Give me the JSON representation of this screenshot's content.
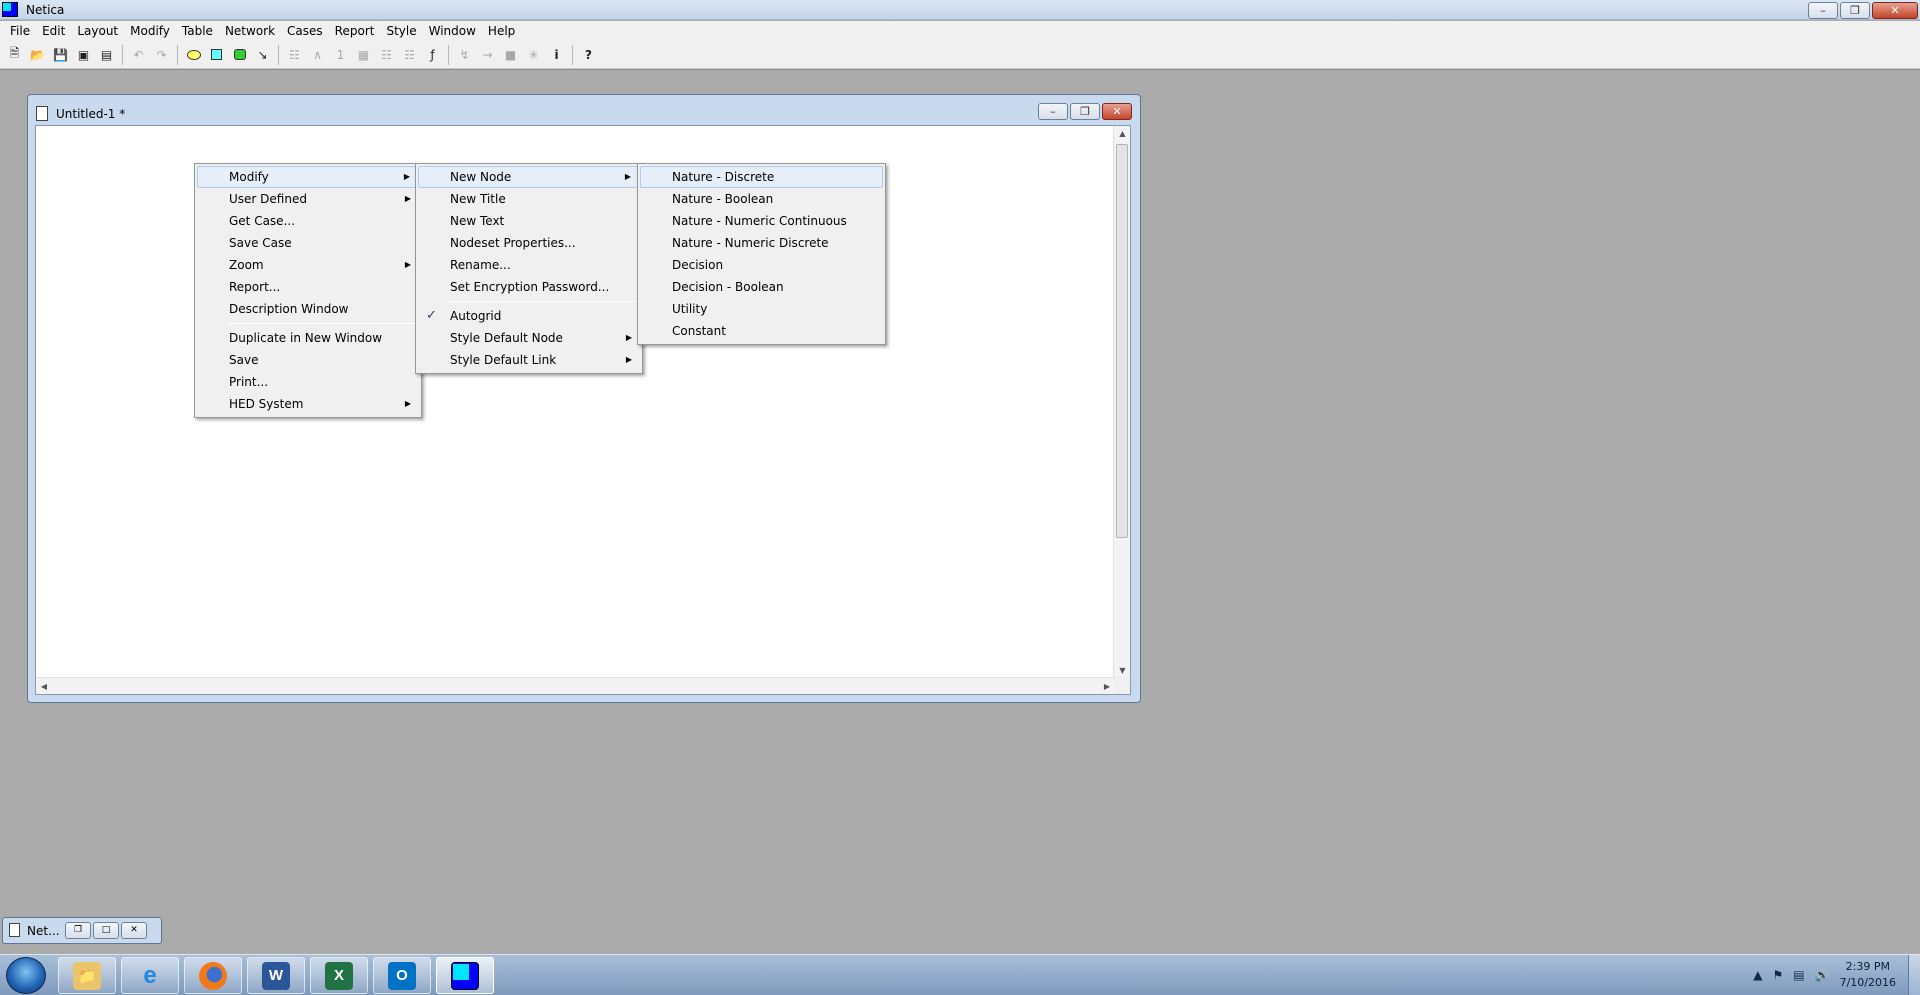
{
  "app": {
    "title": "Netica"
  },
  "menubar": [
    "File",
    "Edit",
    "Layout",
    "Modify",
    "Table",
    "Network",
    "Cases",
    "Report",
    "Style",
    "Window",
    "Help"
  ],
  "child_window": {
    "title": "Untitled-1 *"
  },
  "context_menu": {
    "items": [
      {
        "label": "Modify",
        "submenu": true
      },
      {
        "label": "User Defined",
        "submenu": true
      },
      {
        "label": "Get Case..."
      },
      {
        "label": "Save Case"
      },
      {
        "label": "Zoom",
        "submenu": true
      },
      {
        "label": "Report..."
      },
      {
        "label": "Description Window"
      },
      {
        "label": "Duplicate in New Window"
      },
      {
        "label": "Save"
      },
      {
        "label": "Print..."
      },
      {
        "label": "HED System",
        "submenu": true
      }
    ]
  },
  "modify_menu": {
    "items": [
      {
        "label": "New Node",
        "submenu": true
      },
      {
        "label": "New Title"
      },
      {
        "label": "New Text"
      },
      {
        "label": "Nodeset Properties..."
      },
      {
        "label": "Rename..."
      },
      {
        "label": "Set Encryption Password..."
      },
      {
        "label": "Autogrid",
        "checked": true
      },
      {
        "label": "Style Default Node",
        "submenu": true
      },
      {
        "label": "Style Default Link",
        "submenu": true
      }
    ]
  },
  "new_node_menu": {
    "items": [
      {
        "label": "Nature - Discrete"
      },
      {
        "label": "Nature - Boolean"
      },
      {
        "label": "Nature - Numeric Continuous"
      },
      {
        "label": "Nature - Numeric Discrete"
      },
      {
        "label": "Decision"
      },
      {
        "label": "Decision - Boolean"
      },
      {
        "label": "Utility"
      },
      {
        "label": "Constant"
      }
    ]
  },
  "minimized_window": {
    "label": "Net..."
  },
  "taskbar": {
    "apps": [
      "explorer-icon",
      "internet-explorer-icon",
      "firefox-icon",
      "word-icon",
      "excel-icon",
      "outlook-icon",
      "netica-icon"
    ],
    "clock_time": "2:39 PM",
    "clock_date": "7/10/2016"
  }
}
